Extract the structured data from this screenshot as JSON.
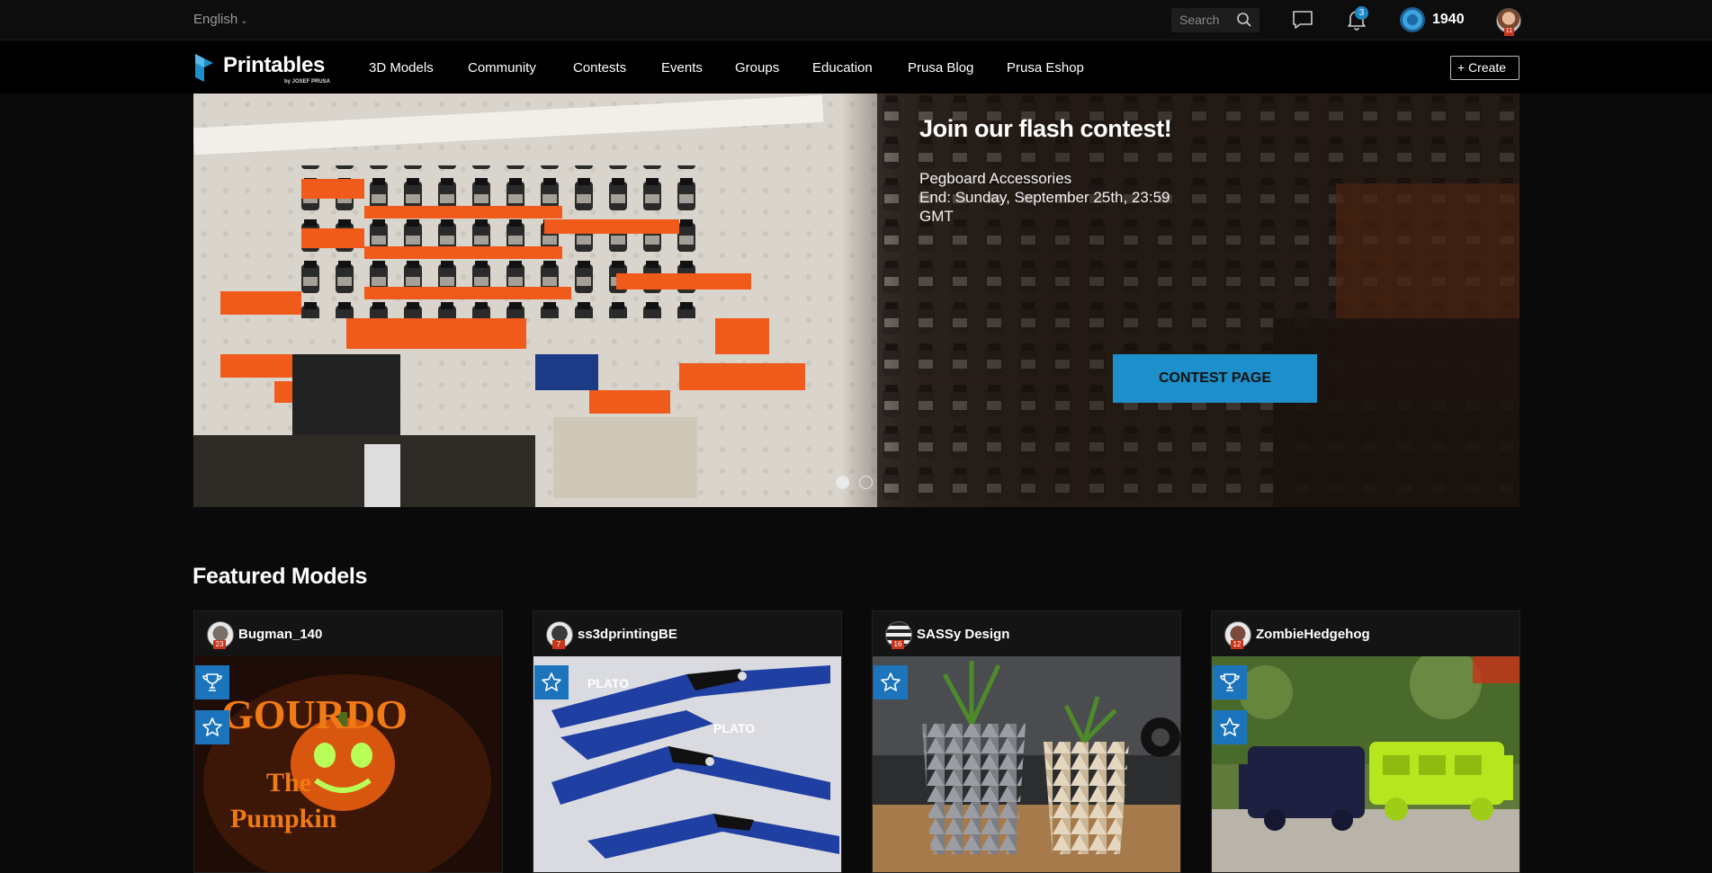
{
  "topbar": {
    "language": "English",
    "search_placeholder": "Search",
    "notification_count": "3",
    "points": "1940",
    "avatar_level": "11"
  },
  "nav": {
    "logo_text": "Printables",
    "logo_byline": "by JOSEF PRUSA",
    "items": [
      "3D Models",
      "Community",
      "Contests",
      "Events",
      "Groups",
      "Education",
      "Prusa Blog",
      "Prusa Eshop"
    ],
    "create_label": "+ Create"
  },
  "hero": {
    "title": "Join our flash contest!",
    "subtitle_line1": "Pegboard Accessories",
    "subtitle_line2": "End: Sunday, September 25th, 23:59 GMT",
    "button_label": "CONTEST PAGE",
    "slides_total": 2,
    "active_slide": 1
  },
  "featured": {
    "title": "Featured Models",
    "cards": [
      {
        "user": "Bugman_140",
        "level": "23",
        "badges": [
          "trophy-icon",
          "star-icon"
        ]
      },
      {
        "user": "ss3dprintingBE",
        "level": "7",
        "badges": [
          "star-icon"
        ]
      },
      {
        "user": "SASSy Design",
        "level": "16",
        "badges": [
          "star-icon"
        ]
      },
      {
        "user": "ZombieHedgehog",
        "level": "12",
        "badges": [
          "trophy-icon",
          "star-icon"
        ]
      }
    ]
  },
  "colors": {
    "accent": "#1d8fca",
    "badge_blue": "#1c75bc",
    "level_red": "#c7351b",
    "background": "#0a0a0a"
  }
}
